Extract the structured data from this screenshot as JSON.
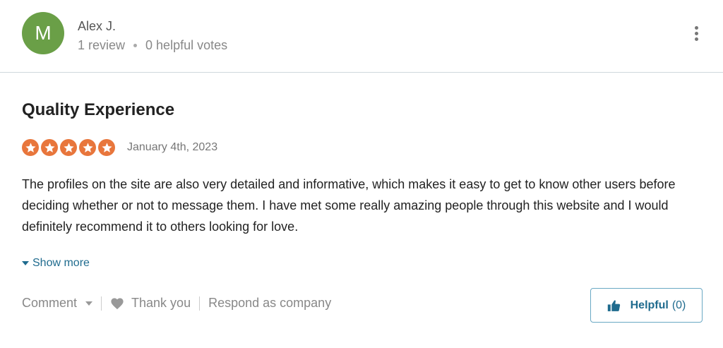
{
  "colors": {
    "avatar_bg": "#6a9f47",
    "star_bg": "#e8763c",
    "link": "#1f6b8e"
  },
  "reviewer": {
    "avatar_initial": "M",
    "name": "Alex J.",
    "review_count": "1 review",
    "helpful_votes": "0 helpful votes"
  },
  "header": {
    "more_icon": "vertical-ellipsis-icon"
  },
  "review": {
    "title": "Quality Experience",
    "rating": 5,
    "rating_max": 5,
    "date": "January 4th, 2023",
    "body": "The profiles on the site are also very detailed and informative, which makes it easy to get to know other users before deciding whether or not to message them. I have met some really amazing people through this website and I would definitely recommend it to others looking for love.",
    "show_more_label": "Show more"
  },
  "actions": {
    "comment_label": "Comment",
    "thank_you_label": "Thank you",
    "respond_label": "Respond as company",
    "helpful_label": "Helpful",
    "helpful_count": "(0)"
  }
}
